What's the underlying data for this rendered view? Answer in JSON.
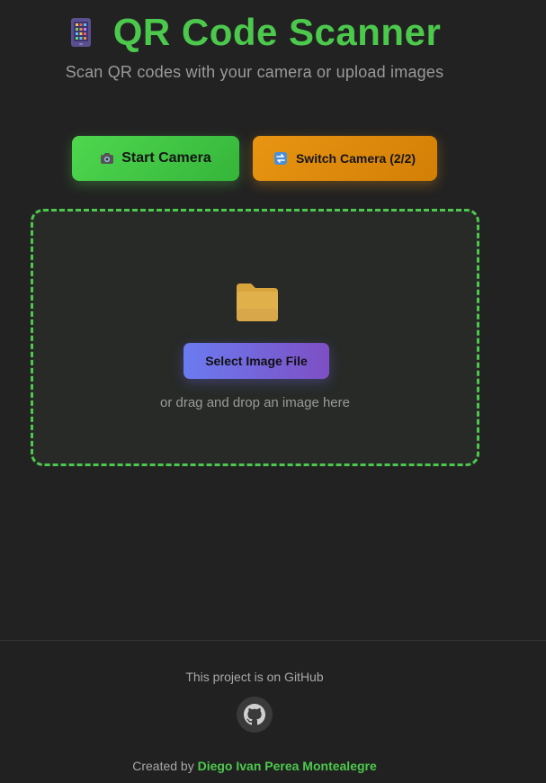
{
  "header": {
    "title": "QR Code Scanner",
    "subtitle": "Scan QR codes with your camera or upload images",
    "icon": "mobile-phone-icon"
  },
  "controls": {
    "start_camera_label": "Start Camera",
    "start_camera_icon": "camera-icon",
    "switch_camera_label": "Switch Camera (2/2)",
    "switch_camera_icon": "switch-arrows-icon"
  },
  "upload": {
    "icon": "folder-icon",
    "select_button_label": "Select Image File",
    "drop_hint": "or drag and drop an image here"
  },
  "footer": {
    "github_text": "This project is on GitHub",
    "github_icon": "github-icon",
    "credit_prefix": "Created by",
    "author_name": "Diego Ivan Perea Montealegre"
  },
  "colors": {
    "accent_green": "#4cc94c",
    "accent_orange": "#e89513",
    "accent_purple": "#7e4fc4",
    "background": "#222222"
  }
}
